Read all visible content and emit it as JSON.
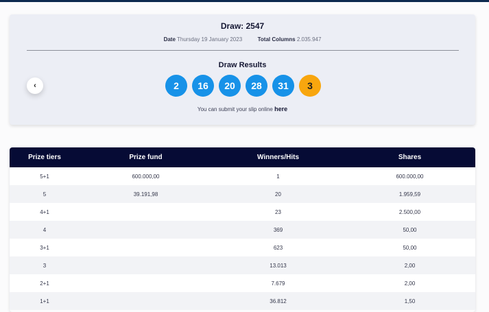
{
  "draw": {
    "title": "Draw: 2547",
    "date_label": "Date",
    "date_value": "Thursday 19 January 2023",
    "columns_label": "Total Columns",
    "columns_value": "2.035.947"
  },
  "results": {
    "title": "Draw Results",
    "numbers": [
      "2",
      "16",
      "20",
      "28",
      "31"
    ],
    "bonus": "3",
    "prev_icon": "chevron-left-icon",
    "prev_glyph": "‹",
    "submit_text": "You can submit your slip online",
    "submit_link": "here"
  },
  "colors": {
    "ball": "#1792e8",
    "bonus_ball": "#f8a60e",
    "table_header": "#060b35"
  },
  "table": {
    "headers": [
      "Prize tiers",
      "Prize fund",
      "Winners/Hits",
      "Shares"
    ],
    "rows": [
      {
        "tier": "5+1",
        "fund": "600.000,00",
        "winners": "1",
        "share": "600.000,00"
      },
      {
        "tier": "5",
        "fund": "39.191,98",
        "winners": "20",
        "share": "1.959,59"
      },
      {
        "tier": "4+1",
        "fund": "",
        "winners": "23",
        "share": "2.500,00"
      },
      {
        "tier": "4",
        "fund": "",
        "winners": "369",
        "share": "50,00"
      },
      {
        "tier": "3+1",
        "fund": "",
        "winners": "623",
        "share": "50,00"
      },
      {
        "tier": "3",
        "fund": "",
        "winners": "13.013",
        "share": "2,00"
      },
      {
        "tier": "2+1",
        "fund": "",
        "winners": "7.679",
        "share": "2,00"
      },
      {
        "tier": "1+1",
        "fund": "",
        "winners": "36.812",
        "share": "1,50"
      }
    ]
  }
}
